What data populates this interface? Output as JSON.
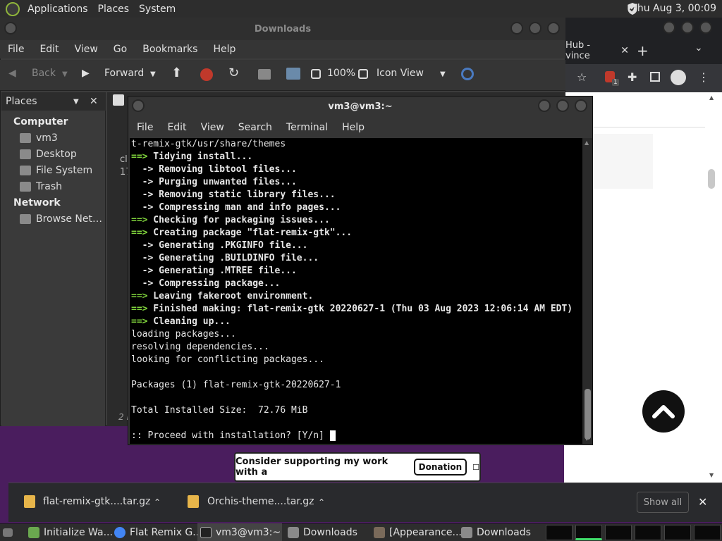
{
  "topbar": {
    "menus": [
      "Applications",
      "Places",
      "System"
    ],
    "clock": "Thu Aug  3, 00:09"
  },
  "chrome": {
    "tab_title": "Hub - vince",
    "new_tab": "+",
    "extension_badge": "1"
  },
  "file_manager": {
    "title": "Downloads",
    "menu": [
      "File",
      "Edit",
      "View",
      "Go",
      "Bookmarks",
      "Help"
    ],
    "toolbar": {
      "back": "Back",
      "forward": "Forward",
      "zoom": "100%",
      "view_mode": "Icon View"
    },
    "sidebar": {
      "header": "Places",
      "sections": [
        {
          "title": "Computer",
          "items": [
            "vm3",
            "Desktop",
            "File System",
            "Trash"
          ]
        },
        {
          "title": "Network",
          "items": [
            "Browse Net…"
          ]
        }
      ]
    },
    "content_partial": [
      "cl",
      "17"
    ],
    "status_partial": "2 i"
  },
  "terminal": {
    "title": "vm3@vm3:~",
    "menu": [
      "File",
      "Edit",
      "View",
      "Search",
      "Terminal",
      "Help"
    ],
    "lines": [
      {
        "kind": "plain",
        "text": "t-remix-gtk/usr/share/themes"
      },
      {
        "kind": "step",
        "prefix": "==>",
        "text": " Tidying install..."
      },
      {
        "kind": "sub",
        "prefix": "  ->",
        "text": " Removing libtool files..."
      },
      {
        "kind": "sub",
        "prefix": "  ->",
        "text": " Purging unwanted files..."
      },
      {
        "kind": "sub",
        "prefix": "  ->",
        "text": " Removing static library files..."
      },
      {
        "kind": "sub",
        "prefix": "  ->",
        "text": " Compressing man and info pages..."
      },
      {
        "kind": "step",
        "prefix": "==>",
        "text": " Checking for packaging issues..."
      },
      {
        "kind": "step",
        "prefix": "==>",
        "text": " Creating package \"flat-remix-gtk\"..."
      },
      {
        "kind": "sub",
        "prefix": "  ->",
        "text": " Generating .PKGINFO file..."
      },
      {
        "kind": "sub",
        "prefix": "  ->",
        "text": " Generating .BUILDINFO file..."
      },
      {
        "kind": "sub",
        "prefix": "  ->",
        "text": " Generating .MTREE file..."
      },
      {
        "kind": "sub",
        "prefix": "  ->",
        "text": " Compressing package..."
      },
      {
        "kind": "step",
        "prefix": "==>",
        "text": " Leaving fakeroot environment."
      },
      {
        "kind": "step",
        "prefix": "==>",
        "text": " Finished making: flat-remix-gtk 20220627-1 (Thu 03 Aug 2023 12:06:14 AM EDT)"
      },
      {
        "kind": "step",
        "prefix": "==>",
        "text": " Cleaning up..."
      },
      {
        "kind": "plain",
        "text": "loading packages..."
      },
      {
        "kind": "plain",
        "text": "resolving dependencies..."
      },
      {
        "kind": "plain",
        "text": "looking for conflicting packages..."
      },
      {
        "kind": "plain",
        "text": ""
      },
      {
        "kind": "plain",
        "text": "Packages (1) flat-remix-gtk-20220627-1"
      },
      {
        "kind": "plain",
        "text": ""
      },
      {
        "kind": "plain",
        "text": "Total Installed Size:  72.76 MiB"
      },
      {
        "kind": "plain",
        "text": ""
      },
      {
        "kind": "plain",
        "text": ":: Proceed with installation? [Y/n] "
      }
    ]
  },
  "donation": {
    "text": "Consider supporting my work with a",
    "button": "Donation"
  },
  "downloads_shelf": {
    "items": [
      "flat-remix-gtk....tar.gz",
      "Orchis-theme....tar.gz"
    ],
    "show_all": "Show all"
  },
  "taskbar": {
    "tasks": [
      {
        "label": "Initialize Wa...",
        "color": "#6aa84f"
      },
      {
        "label": "Flat Remix G...",
        "color": "#4285f4"
      },
      {
        "label": "vm3@vm3:~",
        "color": "#222222"
      },
      {
        "label": "Downloads",
        "color": "#8a8a8a"
      },
      {
        "label": "[Appearance...",
        "color": "#7a6a5a"
      },
      {
        "label": "Downloads",
        "color": "#8a8a8a"
      }
    ]
  },
  "colors": {
    "terminal_green": "#7fd23c",
    "desktop": "#4a1d5e"
  }
}
